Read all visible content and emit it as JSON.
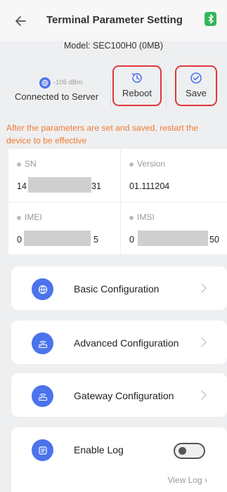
{
  "header": {
    "title": "Terminal Parameter Setting"
  },
  "model": {
    "text": "Model: SEC100H0 (0MB)"
  },
  "status": {
    "signal": "-105 dBm",
    "connection": "Connected to Server"
  },
  "actions": {
    "reboot": "Reboot",
    "save": "Save"
  },
  "notice": "After the parameters are set and saved, restart the device to be effective",
  "info": {
    "sn": {
      "label": "SN",
      "value_start": "14",
      "value_end": "31"
    },
    "version": {
      "label": "Version",
      "value": "01.111204"
    },
    "imei": {
      "label": "IMEI",
      "value_start": "0",
      "value_end": "5"
    },
    "imsi": {
      "label": "IMSI",
      "value_start": "0",
      "value_end": "50"
    }
  },
  "menu": [
    {
      "label": "Basic Configuration",
      "icon": "globe-icon"
    },
    {
      "label": "Advanced Configuration",
      "icon": "router-icon"
    },
    {
      "label": "Gateway Configuration",
      "icon": "router-icon"
    },
    {
      "label": "Enable Log",
      "icon": "log-icon"
    }
  ],
  "view_log": "View Log"
}
